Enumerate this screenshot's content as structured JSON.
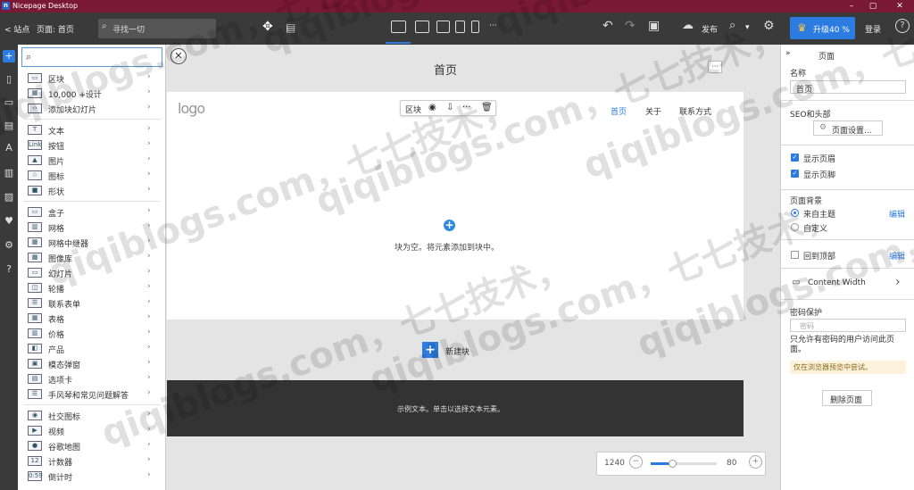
{
  "window": {
    "title": "Nicepage Desktop"
  },
  "toolbar": {
    "site_label": "< 站点",
    "page_label": "页面: 首页",
    "search_placeholder": "寻找一切",
    "publish_label": "发布",
    "upgrade_label": "升级40 %",
    "login_label": "登录"
  },
  "add_panel": {
    "search_placeholder": "",
    "groups": [
      [
        {
          "icon": "block-icon",
          "glyph": "▭",
          "label": "区块"
        },
        {
          "icon": "designs-icon",
          "glyph": "▦",
          "label": "10,000 +设计"
        },
        {
          "icon": "slider-block-icon",
          "glyph": "‹›",
          "label": "添加块幻灯片"
        }
      ],
      [
        {
          "icon": "text-icon",
          "glyph": "T",
          "label": "文本"
        },
        {
          "icon": "link-icon",
          "glyph": "Link",
          "label": "按钮"
        },
        {
          "icon": "image-icon",
          "glyph": "▲",
          "label": "图片"
        },
        {
          "icon": "star-icon",
          "glyph": "☆",
          "label": "图标"
        },
        {
          "icon": "shape-icon",
          "glyph": "■",
          "label": "形状"
        }
      ],
      [
        {
          "icon": "box-icon",
          "glyph": "▭",
          "label": "盒子"
        },
        {
          "icon": "grid-icon",
          "glyph": "▥",
          "label": "网格"
        },
        {
          "icon": "grid-repeater-icon",
          "glyph": "▦",
          "label": "网格中继器"
        },
        {
          "icon": "gallery-icon",
          "glyph": "▩",
          "label": "图像库"
        },
        {
          "icon": "slideshow-icon",
          "glyph": "▭",
          "label": "幻灯片"
        },
        {
          "icon": "carousel-icon",
          "glyph": "◫",
          "label": "轮播"
        },
        {
          "icon": "contact-form-icon",
          "glyph": "☰",
          "label": "联系表单"
        },
        {
          "icon": "table-icon",
          "glyph": "▦",
          "label": "表格"
        },
        {
          "icon": "pricing-icon",
          "glyph": "▥",
          "label": "价格"
        },
        {
          "icon": "product-icon",
          "glyph": "◧",
          "label": "产品"
        },
        {
          "icon": "modal-popup-icon",
          "glyph": "▣",
          "label": "模态弹窗"
        },
        {
          "icon": "tabs-icon",
          "glyph": "▤",
          "label": "选项卡"
        },
        {
          "icon": "accordion-icon",
          "glyph": "☰",
          "label": "手风琴和常见问题解答"
        }
      ],
      [
        {
          "icon": "social-icons-icon",
          "glyph": "◉",
          "label": "社交图标"
        },
        {
          "icon": "video-icon",
          "glyph": "▶",
          "label": "视频"
        },
        {
          "icon": "map-pin-icon",
          "glyph": "●",
          "label": "谷歌地图"
        },
        {
          "icon": "counter-icon",
          "glyph": "12",
          "label": "计数器"
        },
        {
          "icon": "countdown-icon",
          "glyph": "0:59",
          "label": "倒计时"
        }
      ]
    ]
  },
  "canvas": {
    "page_title": "首页",
    "logo_text": "logo",
    "block_toolbar_label": "区块",
    "nav_items": [
      "首页",
      "关于",
      "联系方式"
    ],
    "empty_block_text": "块为空。将元素添加到块中。",
    "new_block_label": "新建块",
    "footer_text": "示例文本。单击以选择文本元素。"
  },
  "zoom": {
    "width_value": "1240",
    "zoom_value": "80",
    "slider_fraction": 0.33
  },
  "right_panel": {
    "header": "页面",
    "name_label": "名称",
    "name_value": "首页",
    "seo_label": "SEO和头部",
    "page_settings_button": "页面设置...",
    "show_header_label": "显示页眉",
    "show_footer_label": "显示页脚",
    "bg_label": "页面背景",
    "bg_option_theme": "来自主题",
    "bg_option_custom": "自定义",
    "bg_edit": "编辑",
    "back_to_top_label": "回到顶部",
    "back_to_top_edit": "编辑",
    "content_width_label": "Content Width",
    "password_label": "密码保护",
    "password_placeholder": "密码",
    "password_help": "只允许有密码的用户访问此页面。",
    "password_note": "仅在浏览器预览中尝试。",
    "delete_button": "删除页面"
  },
  "colors": {
    "titlebar": "#7a1838",
    "accent": "#2b7be0",
    "toolbar": "#3a3a3a"
  },
  "watermark": {
    "text": "qiqiblogs.com，七七技术，"
  }
}
